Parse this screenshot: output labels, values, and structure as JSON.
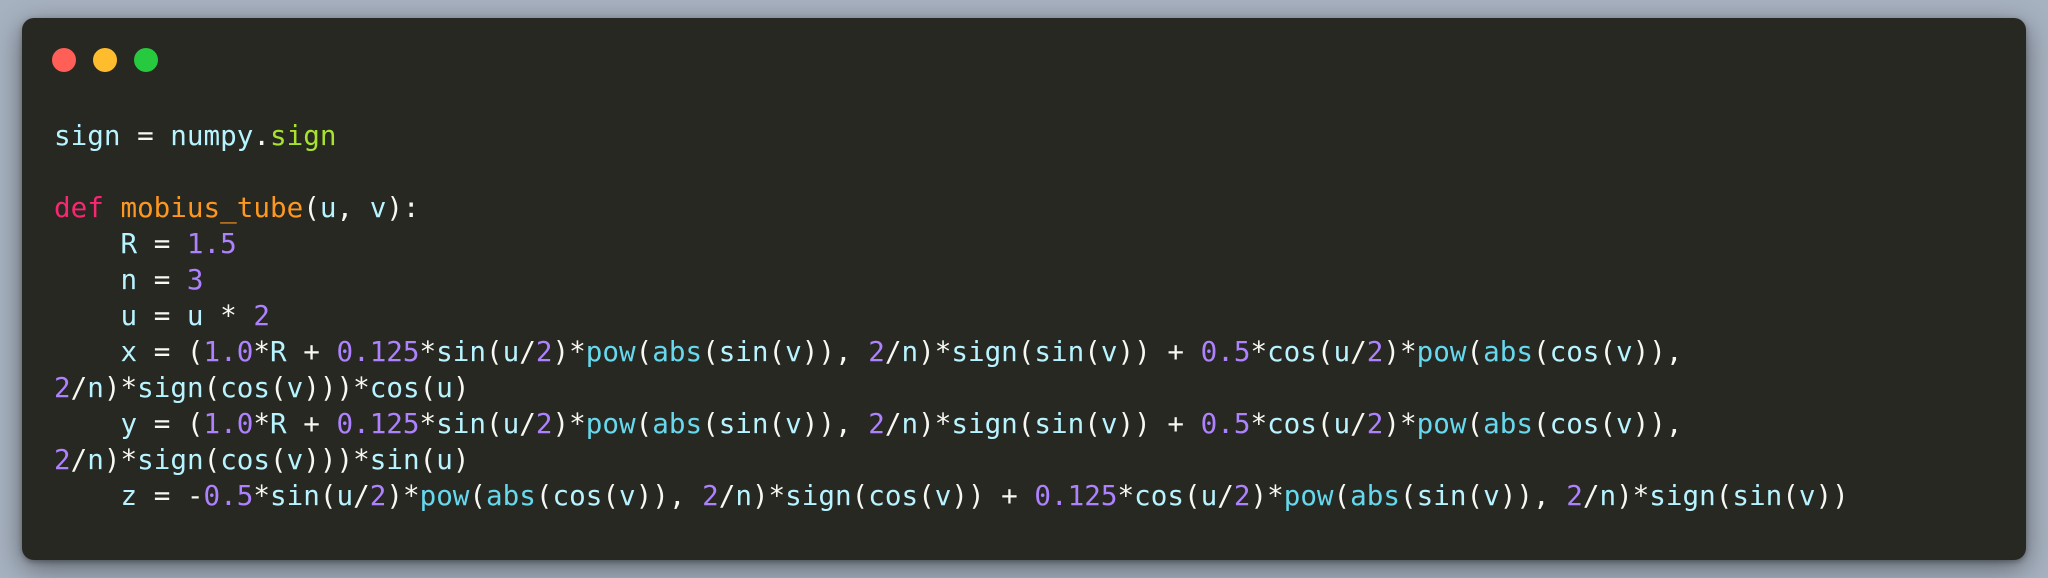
{
  "window": {
    "controls": [
      {
        "name": "close",
        "color": "#ff5f56"
      },
      {
        "name": "minimize",
        "color": "#ffbd2e"
      },
      {
        "name": "maximize",
        "color": "#27c93f"
      }
    ],
    "background": "#272822"
  },
  "colors": {
    "identifier": "#b8f4ff",
    "attribute": "#a6e22e",
    "keyword": "#f92672",
    "function_name": "#fd971f",
    "number": "#ae81ff",
    "builtin_call": "#66d9ef",
    "operator": "#f8f8f2"
  },
  "code": {
    "lines": [
      [
        {
          "t": "sign",
          "k": "id"
        },
        {
          "t": " = ",
          "k": "op"
        },
        {
          "t": "numpy",
          "k": "id"
        },
        {
          "t": ".",
          "k": "op"
        },
        {
          "t": "sign",
          "k": "attr"
        }
      ],
      [],
      [
        {
          "t": "def ",
          "k": "kw"
        },
        {
          "t": "mobius_tube",
          "k": "fn"
        },
        {
          "t": "(",
          "k": "punc"
        },
        {
          "t": "u",
          "k": "id"
        },
        {
          "t": ", ",
          "k": "punc"
        },
        {
          "t": "v",
          "k": "id"
        },
        {
          "t": "):",
          "k": "punc"
        }
      ],
      [
        {
          "t": "    R",
          "k": "id"
        },
        {
          "t": " = ",
          "k": "op"
        },
        {
          "t": "1.5",
          "k": "num"
        }
      ],
      [
        {
          "t": "    n",
          "k": "id"
        },
        {
          "t": " = ",
          "k": "op"
        },
        {
          "t": "3",
          "k": "num"
        }
      ],
      [
        {
          "t": "    u",
          "k": "id"
        },
        {
          "t": " = ",
          "k": "op"
        },
        {
          "t": "u",
          "k": "id"
        },
        {
          "t": " * ",
          "k": "op"
        },
        {
          "t": "2",
          "k": "num"
        }
      ],
      [
        {
          "t": "    x",
          "k": "id"
        },
        {
          "t": " = (",
          "k": "op"
        },
        {
          "t": "1.0",
          "k": "num"
        },
        {
          "t": "*",
          "k": "op"
        },
        {
          "t": "R",
          "k": "id"
        },
        {
          "t": " + ",
          "k": "op"
        },
        {
          "t": "0.125",
          "k": "num"
        },
        {
          "t": "*",
          "k": "op"
        },
        {
          "t": "sin",
          "k": "id"
        },
        {
          "t": "(",
          "k": "punc"
        },
        {
          "t": "u",
          "k": "id"
        },
        {
          "t": "/",
          "k": "op"
        },
        {
          "t": "2",
          "k": "num"
        },
        {
          "t": ")*",
          "k": "op"
        },
        {
          "t": "pow",
          "k": "call"
        },
        {
          "t": "(",
          "k": "punc"
        },
        {
          "t": "abs",
          "k": "call"
        },
        {
          "t": "(",
          "k": "punc"
        },
        {
          "t": "sin",
          "k": "id"
        },
        {
          "t": "(",
          "k": "punc"
        },
        {
          "t": "v",
          "k": "id"
        },
        {
          "t": ")), ",
          "k": "punc"
        },
        {
          "t": "2",
          "k": "num"
        },
        {
          "t": "/",
          "k": "op"
        },
        {
          "t": "n",
          "k": "id"
        },
        {
          "t": ")*",
          "k": "op"
        },
        {
          "t": "sign",
          "k": "id"
        },
        {
          "t": "(",
          "k": "punc"
        },
        {
          "t": "sin",
          "k": "id"
        },
        {
          "t": "(",
          "k": "punc"
        },
        {
          "t": "v",
          "k": "id"
        },
        {
          "t": ")) + ",
          "k": "op"
        },
        {
          "t": "0.5",
          "k": "num"
        },
        {
          "t": "*",
          "k": "op"
        },
        {
          "t": "cos",
          "k": "id"
        },
        {
          "t": "(",
          "k": "punc"
        },
        {
          "t": "u",
          "k": "id"
        },
        {
          "t": "/",
          "k": "op"
        },
        {
          "t": "2",
          "k": "num"
        },
        {
          "t": ")*",
          "k": "op"
        },
        {
          "t": "pow",
          "k": "call"
        },
        {
          "t": "(",
          "k": "punc"
        },
        {
          "t": "abs",
          "k": "call"
        },
        {
          "t": "(",
          "k": "punc"
        },
        {
          "t": "cos",
          "k": "id"
        },
        {
          "t": "(",
          "k": "punc"
        },
        {
          "t": "v",
          "k": "id"
        },
        {
          "t": ")),",
          "k": "punc"
        }
      ],
      [
        {
          "t": "2",
          "k": "num"
        },
        {
          "t": "/",
          "k": "op"
        },
        {
          "t": "n",
          "k": "id"
        },
        {
          "t": ")*",
          "k": "op"
        },
        {
          "t": "sign",
          "k": "id"
        },
        {
          "t": "(",
          "k": "punc"
        },
        {
          "t": "cos",
          "k": "id"
        },
        {
          "t": "(",
          "k": "punc"
        },
        {
          "t": "v",
          "k": "id"
        },
        {
          "t": ")))*",
          "k": "op"
        },
        {
          "t": "cos",
          "k": "id"
        },
        {
          "t": "(",
          "k": "punc"
        },
        {
          "t": "u",
          "k": "id"
        },
        {
          "t": ")",
          "k": "punc"
        }
      ],
      [
        {
          "t": "    y",
          "k": "id"
        },
        {
          "t": " = (",
          "k": "op"
        },
        {
          "t": "1.0",
          "k": "num"
        },
        {
          "t": "*",
          "k": "op"
        },
        {
          "t": "R",
          "k": "id"
        },
        {
          "t": " + ",
          "k": "op"
        },
        {
          "t": "0.125",
          "k": "num"
        },
        {
          "t": "*",
          "k": "op"
        },
        {
          "t": "sin",
          "k": "id"
        },
        {
          "t": "(",
          "k": "punc"
        },
        {
          "t": "u",
          "k": "id"
        },
        {
          "t": "/",
          "k": "op"
        },
        {
          "t": "2",
          "k": "num"
        },
        {
          "t": ")*",
          "k": "op"
        },
        {
          "t": "pow",
          "k": "call"
        },
        {
          "t": "(",
          "k": "punc"
        },
        {
          "t": "abs",
          "k": "call"
        },
        {
          "t": "(",
          "k": "punc"
        },
        {
          "t": "sin",
          "k": "id"
        },
        {
          "t": "(",
          "k": "punc"
        },
        {
          "t": "v",
          "k": "id"
        },
        {
          "t": ")), ",
          "k": "punc"
        },
        {
          "t": "2",
          "k": "num"
        },
        {
          "t": "/",
          "k": "op"
        },
        {
          "t": "n",
          "k": "id"
        },
        {
          "t": ")*",
          "k": "op"
        },
        {
          "t": "sign",
          "k": "id"
        },
        {
          "t": "(",
          "k": "punc"
        },
        {
          "t": "sin",
          "k": "id"
        },
        {
          "t": "(",
          "k": "punc"
        },
        {
          "t": "v",
          "k": "id"
        },
        {
          "t": ")) + ",
          "k": "op"
        },
        {
          "t": "0.5",
          "k": "num"
        },
        {
          "t": "*",
          "k": "op"
        },
        {
          "t": "cos",
          "k": "id"
        },
        {
          "t": "(",
          "k": "punc"
        },
        {
          "t": "u",
          "k": "id"
        },
        {
          "t": "/",
          "k": "op"
        },
        {
          "t": "2",
          "k": "num"
        },
        {
          "t": ")*",
          "k": "op"
        },
        {
          "t": "pow",
          "k": "call"
        },
        {
          "t": "(",
          "k": "punc"
        },
        {
          "t": "abs",
          "k": "call"
        },
        {
          "t": "(",
          "k": "punc"
        },
        {
          "t": "cos",
          "k": "id"
        },
        {
          "t": "(",
          "k": "punc"
        },
        {
          "t": "v",
          "k": "id"
        },
        {
          "t": ")),",
          "k": "punc"
        }
      ],
      [
        {
          "t": "2",
          "k": "num"
        },
        {
          "t": "/",
          "k": "op"
        },
        {
          "t": "n",
          "k": "id"
        },
        {
          "t": ")*",
          "k": "op"
        },
        {
          "t": "sign",
          "k": "id"
        },
        {
          "t": "(",
          "k": "punc"
        },
        {
          "t": "cos",
          "k": "id"
        },
        {
          "t": "(",
          "k": "punc"
        },
        {
          "t": "v",
          "k": "id"
        },
        {
          "t": ")))*",
          "k": "op"
        },
        {
          "t": "sin",
          "k": "id"
        },
        {
          "t": "(",
          "k": "punc"
        },
        {
          "t": "u",
          "k": "id"
        },
        {
          "t": ")",
          "k": "punc"
        }
      ],
      [
        {
          "t": "    z",
          "k": "id"
        },
        {
          "t": " = -",
          "k": "op"
        },
        {
          "t": "0.5",
          "k": "num"
        },
        {
          "t": "*",
          "k": "op"
        },
        {
          "t": "sin",
          "k": "id"
        },
        {
          "t": "(",
          "k": "punc"
        },
        {
          "t": "u",
          "k": "id"
        },
        {
          "t": "/",
          "k": "op"
        },
        {
          "t": "2",
          "k": "num"
        },
        {
          "t": ")*",
          "k": "op"
        },
        {
          "t": "pow",
          "k": "call"
        },
        {
          "t": "(",
          "k": "punc"
        },
        {
          "t": "abs",
          "k": "call"
        },
        {
          "t": "(",
          "k": "punc"
        },
        {
          "t": "cos",
          "k": "id"
        },
        {
          "t": "(",
          "k": "punc"
        },
        {
          "t": "v",
          "k": "id"
        },
        {
          "t": ")), ",
          "k": "punc"
        },
        {
          "t": "2",
          "k": "num"
        },
        {
          "t": "/",
          "k": "op"
        },
        {
          "t": "n",
          "k": "id"
        },
        {
          "t": ")*",
          "k": "op"
        },
        {
          "t": "sign",
          "k": "id"
        },
        {
          "t": "(",
          "k": "punc"
        },
        {
          "t": "cos",
          "k": "id"
        },
        {
          "t": "(",
          "k": "punc"
        },
        {
          "t": "v",
          "k": "id"
        },
        {
          "t": ")) + ",
          "k": "op"
        },
        {
          "t": "0.125",
          "k": "num"
        },
        {
          "t": "*",
          "k": "op"
        },
        {
          "t": "cos",
          "k": "id"
        },
        {
          "t": "(",
          "k": "punc"
        },
        {
          "t": "u",
          "k": "id"
        },
        {
          "t": "/",
          "k": "op"
        },
        {
          "t": "2",
          "k": "num"
        },
        {
          "t": ")*",
          "k": "op"
        },
        {
          "t": "pow",
          "k": "call"
        },
        {
          "t": "(",
          "k": "punc"
        },
        {
          "t": "abs",
          "k": "call"
        },
        {
          "t": "(",
          "k": "punc"
        },
        {
          "t": "sin",
          "k": "id"
        },
        {
          "t": "(",
          "k": "punc"
        },
        {
          "t": "v",
          "k": "id"
        },
        {
          "t": ")), ",
          "k": "punc"
        },
        {
          "t": "2",
          "k": "num"
        },
        {
          "t": "/",
          "k": "op"
        },
        {
          "t": "n",
          "k": "id"
        },
        {
          "t": ")*",
          "k": "op"
        },
        {
          "t": "sign",
          "k": "id"
        },
        {
          "t": "(",
          "k": "punc"
        },
        {
          "t": "sin",
          "k": "id"
        },
        {
          "t": "(",
          "k": "punc"
        },
        {
          "t": "v",
          "k": "id"
        },
        {
          "t": "))",
          "k": "punc"
        }
      ]
    ]
  }
}
